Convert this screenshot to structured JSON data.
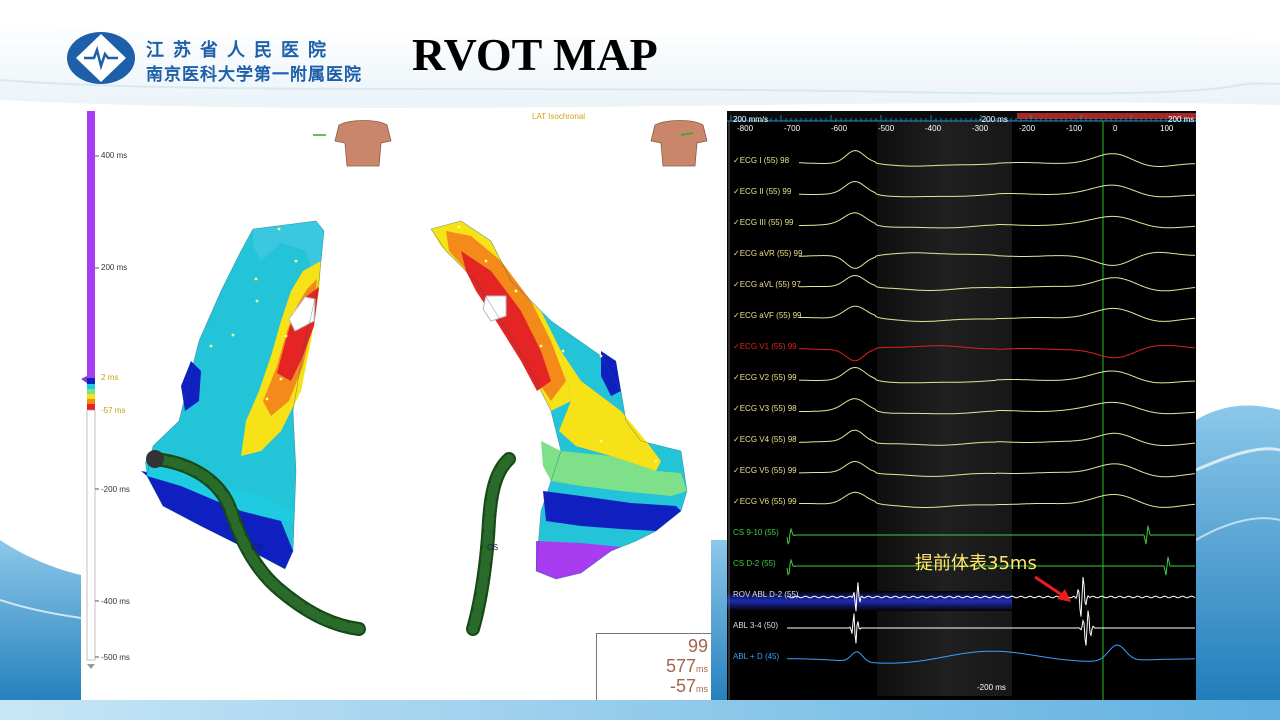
{
  "header": {
    "hospital_name_1": "江苏省人民医院",
    "hospital_name_2": "南京医科大学第一附属医院",
    "title": "RVOT MAP"
  },
  "map_panel": {
    "map_title": "LAT Isochronal",
    "scale_ticks": [
      "400 ms",
      "200 ms",
      "2 ms",
      "-57 ms",
      "-200 ms",
      "-400 ms",
      "-500 ms"
    ],
    "scale_colors": [
      "#a83cf0",
      "#1020c0",
      "#1ecbe1",
      "#f7e218",
      "#f48a1a",
      "#e52424",
      "#ffffff"
    ],
    "catheter_labels": [
      "CS",
      "CS"
    ],
    "readout": {
      "value_1": "99",
      "value_2": "577",
      "unit_2": "ms",
      "value_3": "-57",
      "unit_3": "ms"
    }
  },
  "ecg_panel": {
    "speed_label": "200 mm/s",
    "window_label": "-200 ms",
    "right_label": "200 ms",
    "axis_ticks": [
      "-800",
      "-700",
      "-600",
      "-500",
      "-400",
      "-300",
      "-200",
      "-100",
      "0",
      "100"
    ],
    "channels": [
      {
        "label": "ECG I (55)  98",
        "color": "#e6e08a",
        "checked": true
      },
      {
        "label": "ECG II (55)  99",
        "color": "#e6e08a",
        "checked": true
      },
      {
        "label": "ECG III (55)  99",
        "color": "#e6e08a",
        "checked": true
      },
      {
        "label": "ECG aVR (55)  99",
        "color": "#e6e08a",
        "checked": true
      },
      {
        "label": "ECG aVL (55)  97",
        "color": "#e6e08a",
        "checked": true
      },
      {
        "label": "ECG aVF (55)  99",
        "color": "#e6e08a",
        "checked": true
      },
      {
        "label": "ECG V1 (55)  99",
        "color": "#e02020",
        "checked": true
      },
      {
        "label": "ECG V2 (55)  99",
        "color": "#e6e08a",
        "checked": true
      },
      {
        "label": "ECG V3 (55)  98",
        "color": "#e6e08a",
        "checked": true
      },
      {
        "label": "ECG V4 (55)  98",
        "color": "#e6e08a",
        "checked": true
      },
      {
        "label": "ECG V5 (55)  99",
        "color": "#e6e08a",
        "checked": true
      },
      {
        "label": "ECG V6 (55)  99",
        "color": "#e6e08a",
        "checked": true
      },
      {
        "label": "CS   9-10 (55)",
        "color": "#3fcf3f",
        "checked": false
      },
      {
        "label": "CS   D-2 (55)",
        "color": "#3fcf3f",
        "checked": false
      },
      {
        "label": "ROV ABL   D-2 (55)",
        "color": "#ffffff",
        "checked": false
      },
      {
        "label": "ABL   3-4 (50)",
        "color": "#ffffff",
        "checked": false
      },
      {
        "label": "ABL + D (45)",
        "color": "#3aa0ff",
        "checked": false
      }
    ],
    "annotation": "提前体表35ms",
    "bottom_label": "-200 ms"
  }
}
